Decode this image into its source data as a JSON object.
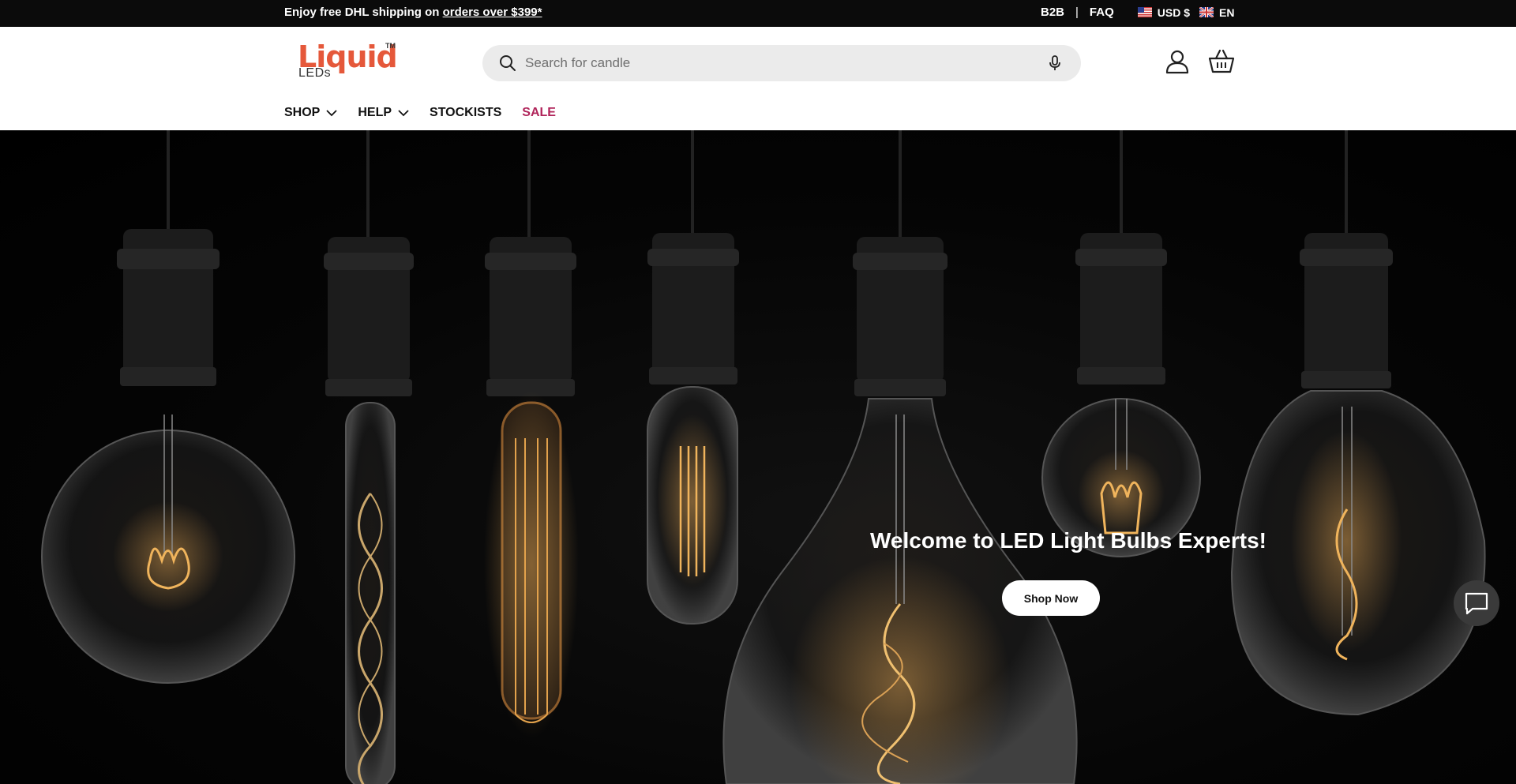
{
  "announcement": {
    "text": "Enjoy free DHL shipping on ",
    "link": "orders over $399*",
    "b2b": "B2B",
    "separator": "|",
    "faq": "FAQ",
    "currency": "USD $",
    "language": "EN"
  },
  "header": {
    "logo_word": "Liquid",
    "logo_tm": "TM",
    "logo_sub": "LEDs",
    "search_placeholder": "Search for candle"
  },
  "nav": {
    "shop": "SHOP",
    "help": "HELP",
    "stockists": "STOCKISTS",
    "sale": "SALE"
  },
  "hero": {
    "title": "Welcome to LED Light Bulbs Experts!",
    "button": "Shop Now"
  },
  "colors": {
    "sale": "#b0245a",
    "logo": "#e5583a",
    "bulb_glow": "#e8a44a"
  },
  "icons": [
    "search-icon",
    "microphone-icon",
    "account-icon",
    "cart-icon",
    "chevron-down-icon",
    "chat-icon",
    "us-flag-icon",
    "uk-flag-icon"
  ]
}
